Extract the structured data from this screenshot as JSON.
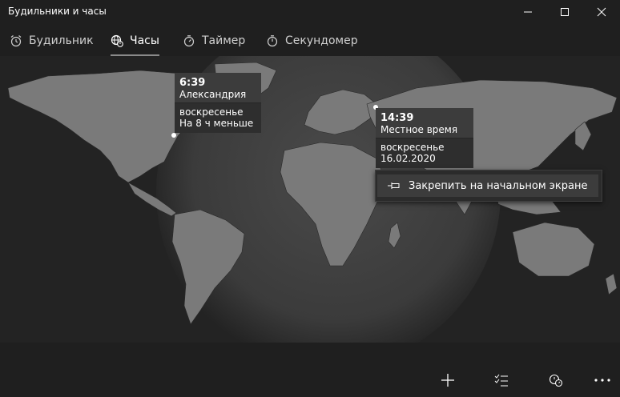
{
  "window": {
    "title": "Будильники и часы"
  },
  "tabs": [
    {
      "label": "Будильник",
      "icon": "alarm-clock-icon"
    },
    {
      "label": "Часы",
      "icon": "globe-clock-icon",
      "active": true
    },
    {
      "label": "Таймер",
      "icon": "timer-icon"
    },
    {
      "label": "Секундомер",
      "icon": "stopwatch-icon"
    }
  ],
  "clocks": [
    {
      "time": "6:39",
      "place": "Александрия",
      "day": "воскресенье",
      "diff": "На 8 ч меньше"
    },
    {
      "time": "14:39",
      "place": "Местное время",
      "day": "воскресенье",
      "date": "16.02.2020"
    }
  ],
  "context_menu": {
    "pin_label": "Закрепить на начальном экране"
  },
  "colors": {
    "background": "#1f1f1f",
    "map_day": "#3a3a3a",
    "land": "#7a7a7a",
    "card": "#3a3a3a"
  }
}
